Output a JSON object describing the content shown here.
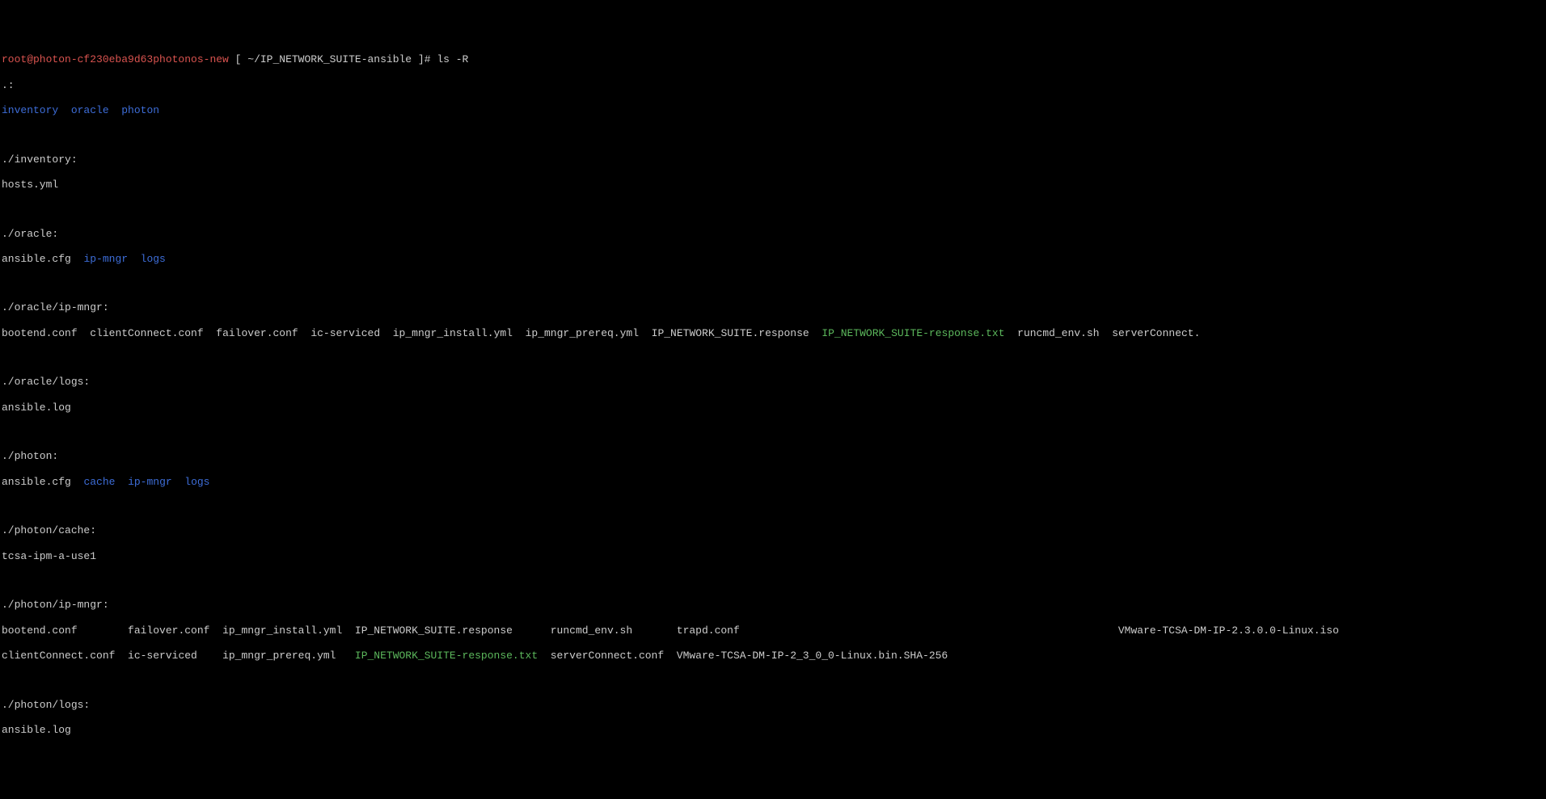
{
  "prompt": {
    "user_host": "root@photon-cf230eba9d63photonos-new",
    "path_open": " [ ",
    "path": "~/IP_NETWORK_SUITE-ansible",
    "path_close": " ]# ",
    "command": "ls -R"
  },
  "root": {
    "header": ".:",
    "items": [
      "inventory",
      "oracle",
      "photon"
    ]
  },
  "inventory": {
    "header": "./inventory:",
    "items": [
      "hosts.yml"
    ]
  },
  "oracle": {
    "header": "./oracle:",
    "items": [
      "ansible.cfg",
      "ip-mngr",
      "logs"
    ]
  },
  "oracle_ip_mngr": {
    "header": "./oracle/ip-mngr:",
    "items": [
      "bootend.conf",
      "clientConnect.conf",
      "failover.conf",
      "ic-serviced",
      "ip_mngr_install.yml",
      "ip_mngr_prereq.yml",
      "IP_NETWORK_SUITE.response",
      "IP_NETWORK_SUITE-response.txt",
      "runcmd_env.sh",
      "serverConnect."
    ]
  },
  "oracle_logs": {
    "header": "./oracle/logs:",
    "items": [
      "ansible.log"
    ]
  },
  "photon": {
    "header": "./photon:",
    "items": [
      "ansible.cfg",
      "cache",
      "ip-mngr",
      "logs"
    ]
  },
  "photon_cache": {
    "header": "./photon/cache:",
    "items": [
      "tcsa-ipm-a-use1"
    ]
  },
  "photon_ip_mngr": {
    "header": "./photon/ip-mngr:",
    "row1": [
      "bootend.conf",
      "failover.conf",
      "ip_mngr_install.yml",
      "IP_NETWORK_SUITE.response",
      "runcmd_env.sh",
      "trapd.conf",
      "VMware-TCSA-DM-IP-2.3.0.0-Linux.iso"
    ],
    "row2": [
      "clientConnect.conf",
      "ic-serviced",
      "ip_mngr_prereq.yml",
      "IP_NETWORK_SUITE-response.txt",
      "serverConnect.conf",
      "VMware-TCSA-DM-IP-2_3_0_0-Linux.bin.SHA-256",
      ""
    ]
  },
  "photon_logs": {
    "header": "./photon/logs:",
    "items": [
      "ansible.log"
    ]
  }
}
